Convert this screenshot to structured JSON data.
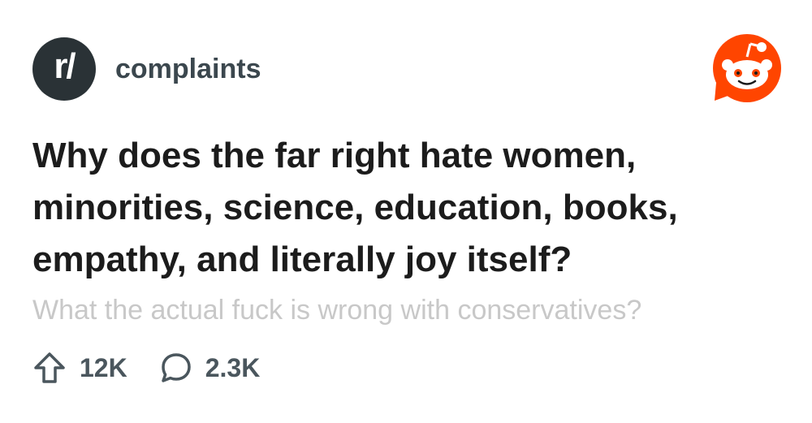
{
  "subreddit": {
    "avatar_text": "r/",
    "name": "complaints"
  },
  "logo": {
    "icon": "reddit-snoo-icon",
    "color": "#ff4500"
  },
  "post": {
    "title": "Why does the far right hate women, minorities, science, education, books, empathy, and literally joy itself?",
    "body": "What the actual fuck is wrong with conservatives?"
  },
  "stats": {
    "upvote_icon": "upvote-arrow-icon",
    "upvotes": "12K",
    "comment_icon": "comment-bubble-icon",
    "comments": "2.3K"
  },
  "colors": {
    "avatar_bg": "#2a3236",
    "subreddit_text": "#3b474e",
    "title_text": "#1c1c1c",
    "body_text": "#c8c8c8",
    "stats_text": "#4a565d",
    "accent": "#ff4500"
  }
}
